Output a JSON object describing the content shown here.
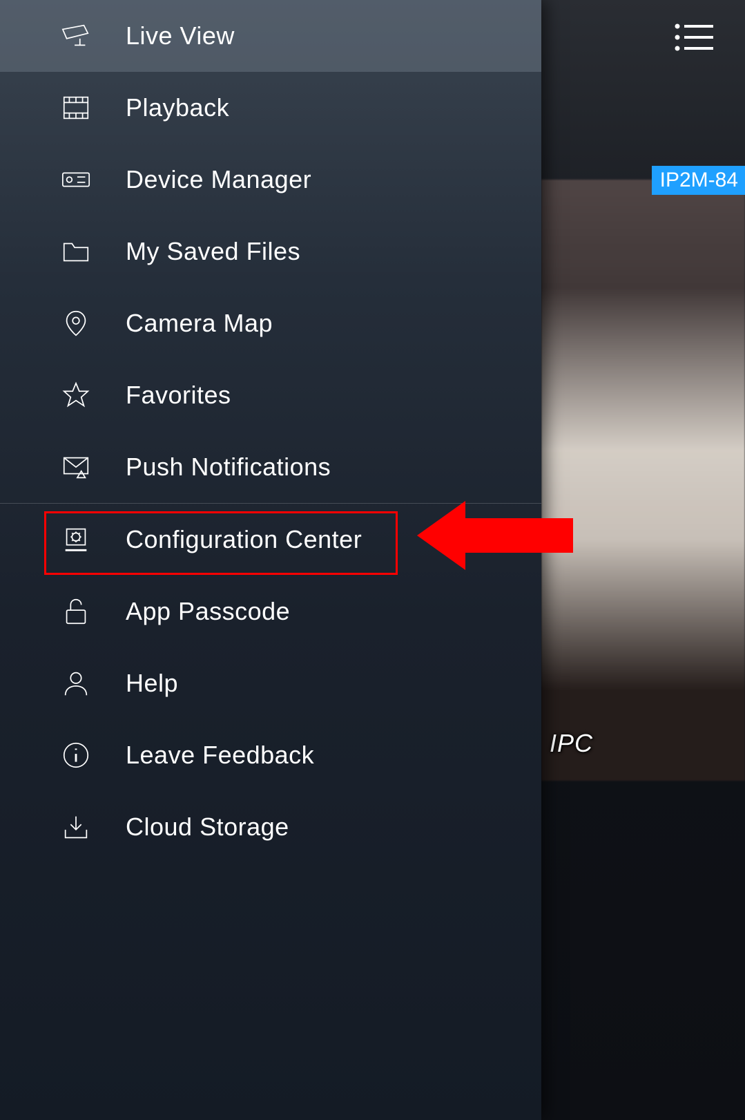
{
  "sidebar": {
    "items": [
      {
        "label": "Live View",
        "icon": "camera-icon",
        "active": true
      },
      {
        "label": "Playback",
        "icon": "film-icon",
        "active": false
      },
      {
        "label": "Device Manager",
        "icon": "device-icon",
        "active": false
      },
      {
        "label": "My Saved Files",
        "icon": "folder-icon",
        "active": false
      },
      {
        "label": "Camera Map",
        "icon": "map-pin-icon",
        "active": false
      },
      {
        "label": "Favorites",
        "icon": "star-icon",
        "active": false
      },
      {
        "label": "Push Notifications",
        "icon": "envelope-alert-icon",
        "active": false
      },
      {
        "label": "Configuration Center",
        "icon": "config-center-icon",
        "active": false
      },
      {
        "label": "App Passcode",
        "icon": "lock-icon",
        "active": false
      },
      {
        "label": "Help",
        "icon": "user-icon",
        "active": false
      },
      {
        "label": "Leave Feedback",
        "icon": "info-icon",
        "active": false
      },
      {
        "label": "Cloud Storage",
        "icon": "download-icon",
        "active": false
      }
    ]
  },
  "feed": {
    "badge_text": "IP2M-84",
    "overlay_label": "IPC"
  },
  "annotation": {
    "highlighted_item_index": 7,
    "color": "#ff0000"
  }
}
